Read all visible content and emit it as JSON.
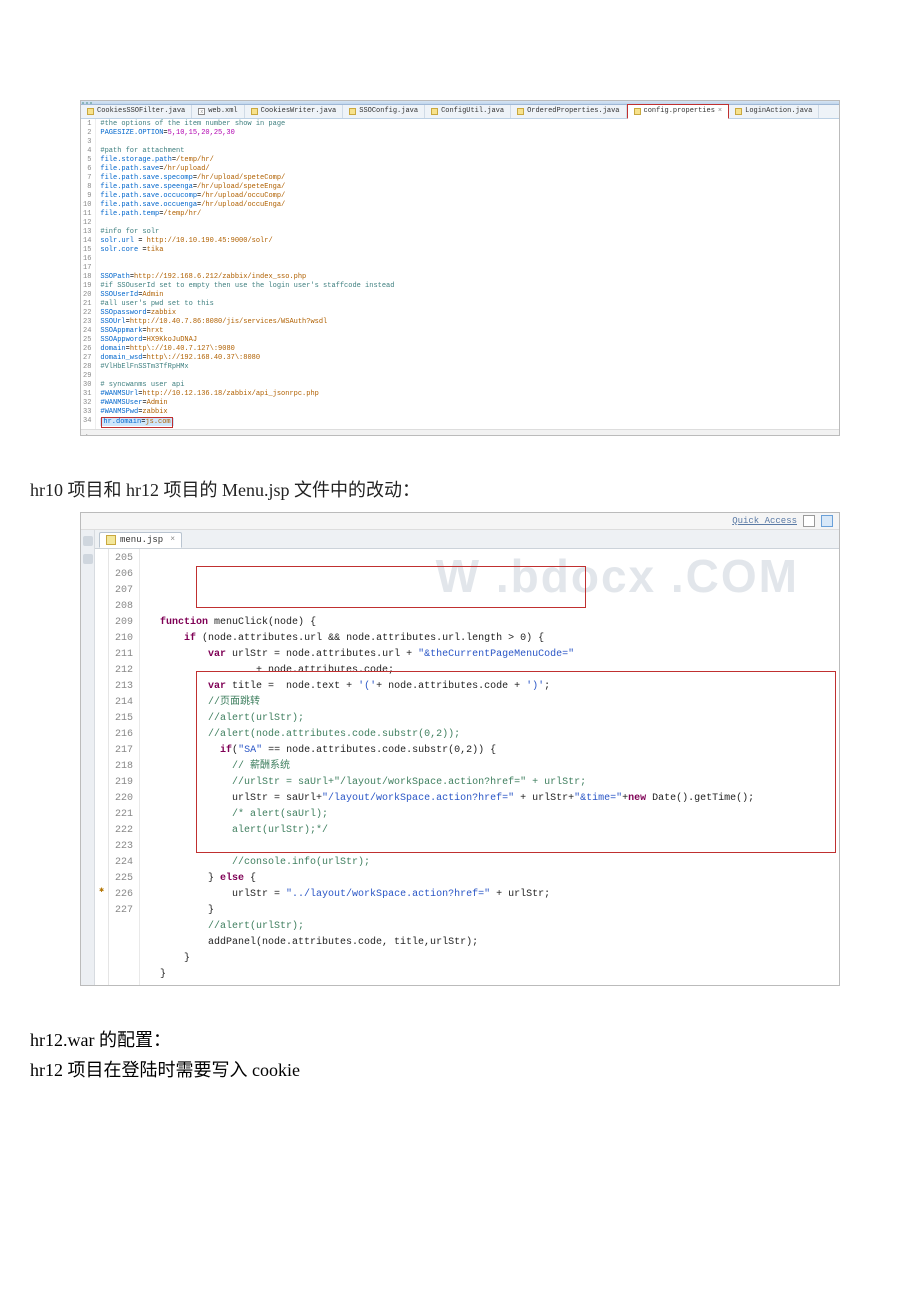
{
  "editor1": {
    "tabs": [
      {
        "icon": "java-icon",
        "label": "CookiesSSOFilter.java"
      },
      {
        "icon": "xml-icon",
        "label": "web.xml"
      },
      {
        "icon": "java-icon",
        "label": "CookiesWriter.java"
      },
      {
        "icon": "java-icon",
        "label": "SSOConfig.java"
      },
      {
        "icon": "java-icon",
        "label": "ConfigUtil.java"
      },
      {
        "icon": "java-icon",
        "label": "OrderedProperties.java"
      },
      {
        "icon": "prop-icon",
        "label": "config.properties",
        "active": true
      },
      {
        "icon": "java-icon",
        "label": "LoginAction.java"
      }
    ],
    "lines": [
      {
        "n": 1,
        "html": "<span class='c-comment'>#the options of the item number show in page</span>"
      },
      {
        "n": 2,
        "html": "<span class='c-key'>PAGESIZE.OPTION</span>=<span class='c-num'>5,10,15,20,25,30</span>"
      },
      {
        "n": 3,
        "html": ""
      },
      {
        "n": 4,
        "html": "<span class='c-comment'>#path for attachment</span>"
      },
      {
        "n": 5,
        "html": "<span class='c-key'>file.storage.path</span>=<span class='c-val'>/temp/hr/</span>"
      },
      {
        "n": 6,
        "html": "<span class='c-key'>file.path.save</span>=<span class='c-val'>/hr/upload/</span>"
      },
      {
        "n": 7,
        "html": "<span class='c-key'>file.path.save.specomp</span>=<span class='c-val'>/hr/upload/speteComp/</span>"
      },
      {
        "n": 8,
        "html": "<span class='c-key'>file.path.save.speenga</span>=<span class='c-val'>/hr/upload/speteEnga/</span>"
      },
      {
        "n": 9,
        "html": "<span class='c-key'>file.path.save.occucomp</span>=<span class='c-val'>/hr/upload/occuComp/</span>"
      },
      {
        "n": 10,
        "html": "<span class='c-key'>file.path.save.occuenga</span>=<span class='c-val'>/hr/upload/occuEnga/</span>"
      },
      {
        "n": 11,
        "html": "<span class='c-key'>file.path.temp</span>=<span class='c-val'>/temp/hr/</span>"
      },
      {
        "n": 12,
        "html": ""
      },
      {
        "n": 13,
        "html": "<span class='c-comment'>#info for solr</span>"
      },
      {
        "n": 14,
        "html": "<span class='c-key'>solr.url</span> = <span class='c-val'>http://10.10.190.45:9000/solr/</span>"
      },
      {
        "n": 15,
        "html": "<span class='c-key'>solr.core</span> =<span class='c-val'>tika</span>"
      },
      {
        "n": 16,
        "html": ""
      },
      {
        "n": 17,
        "html": ""
      },
      {
        "n": 18,
        "html": "<span class='c-key'>SSOPath</span>=<span class='c-val'>http://192.168.6.212/zabbix/index_sso.php</span>"
      },
      {
        "n": 19,
        "html": "<span class='c-comment'>#if SSOuserId set to empty then use the login user's staffcode instead</span>"
      },
      {
        "n": 20,
        "html": "<span class='c-key'>SSOUserId</span>=<span class='c-val'>Admin</span>"
      },
      {
        "n": 21,
        "html": "<span class='c-comment'>#all user's pwd set to this</span>"
      },
      {
        "n": 22,
        "html": "<span class='c-key'>SSOpassword</span>=<span class='c-val'>zabbix</span>"
      },
      {
        "n": 23,
        "html": "<span class='c-key'>SSOUrl</span>=<span class='c-val'>http://10.40.7.86:8080/jis/services/WSAuth?wsdl</span>"
      },
      {
        "n": 24,
        "html": "<span class='c-key'>SSOAppmark</span>=<span class='c-val'>hrxt</span>"
      },
      {
        "n": 25,
        "html": "<span class='c-key'>SSOAppword</span>=<span class='c-val'>HX9KkoJuDNAJ</span>"
      },
      {
        "n": 26,
        "html": "<span class='c-key'>domain</span>=<span class='c-val'>http\\://10.40.7.127\\:9080</span>"
      },
      {
        "n": 27,
        "html": "<span class='c-key'>domain_wsd</span>=<span class='c-val'>http\\://192.168.40.37\\:8080</span>"
      },
      {
        "n": 28,
        "html": "<span class='c-comment'>#VlHbElFnSSTm3TfRpHMx</span>"
      },
      {
        "n": 29,
        "html": ""
      },
      {
        "n": 30,
        "html": "<span class='c-comment'># syncwanms user api</span>"
      },
      {
        "n": 31,
        "html": "<span class='c-key'>#WANMSUrl</span>=<span class='c-val'>http://10.12.136.18/zabbix/api_jsonrpc.php</span>"
      },
      {
        "n": 32,
        "html": "<span class='c-key'>#WANMSUser</span>=<span class='c-val'>Admin</span>"
      },
      {
        "n": 33,
        "html": "<span class='c-key'>#WANMSPwd</span>=<span class='c-val'>zabbix</span>"
      },
      {
        "n": 34,
        "html": "<span class='ed1-hl-cursor'><span class='c-key'>hr.domain</span>=<span class='c-val'>js.com</span></span>"
      }
    ],
    "footer": "."
  },
  "bodyText1": "hr10 项目和 hr12 项目的 Menu.jsp 文件中的改动：",
  "editor2": {
    "topbar": {
      "quickAccess": "Quick Access"
    },
    "tab": {
      "label": "menu.jsp",
      "close": "×"
    },
    "watermark": "W .bdocx .COM",
    "lines": [
      {
        "n": 205,
        "html": "  <span class='js-kw'>function</span> menuClick(node) {"
      },
      {
        "n": 206,
        "html": "      <span class='js-kw'>if</span> (node.attributes.url && node.attributes.url.length &gt; 0) {"
      },
      {
        "n": 207,
        "html": "          <span class='js-kw'>var</span> urlStr = node.attributes.url + <span class='js-str'>\"&amp;theCurrentPageMenuCode=\"</span>"
      },
      {
        "n": 208,
        "html": "                  + node.attributes.code;"
      },
      {
        "n": 209,
        "html": "          <span class='js-kw'>var</span> title =  node.text + <span class='js-str'>'('</span>+ node.attributes.code + <span class='js-str'>')'</span>;"
      },
      {
        "n": 210,
        "html": "          <span class='js-com'>//页面跳转</span>"
      },
      {
        "n": 211,
        "html": "          <span class='js-com'>//alert(urlStr);</span>"
      },
      {
        "n": 212,
        "html": "          <span class='js-com'>//alert(node.attributes.code.substr(0,2));</span>"
      },
      {
        "n": 213,
        "html": "            <span class='js-kw'>if</span>(<span class='js-str'>\"SA\"</span> == node.attributes.code.substr(0,2)) {"
      },
      {
        "n": 214,
        "html": "              <span class='js-com'>// 薪酬系统</span>"
      },
      {
        "n": 215,
        "html": "              <span class='js-com'>//urlStr = saUrl+\"/layout/workSpace.action?href=\" + urlStr;</span>"
      },
      {
        "n": 216,
        "html": "              urlStr = saUrl+<span class='js-str'>\"/layout/workSpace.action?href=\"</span> + urlStr+<span class='js-str'>\"&amp;time=\"</span>+<span class='js-kw'>new</span> Date().getTime();"
      },
      {
        "n": 217,
        "html": "              <span class='js-com'>/* alert(saUrl);</span>"
      },
      {
        "n": 218,
        "html": "<span class='js-com'>              alert(urlStr);*/</span>"
      },
      {
        "n": 219,
        "html": ""
      },
      {
        "n": 220,
        "html": "              <span class='js-com'>//console.info(urlStr);</span>"
      },
      {
        "n": 221,
        "html": "          } <span class='js-kw'>else</span> {"
      },
      {
        "n": 222,
        "html": "              urlStr = <span class='js-str'>\"../layout/workSpace.action?href=\"</span> + urlStr;"
      },
      {
        "n": 223,
        "html": "          }"
      },
      {
        "n": 224,
        "html": "          <span class='js-com'>//alert(urlStr);</span>"
      },
      {
        "n": 225,
        "html": "          addPanel(node.attributes.code, title,urlStr);"
      },
      {
        "n": 226,
        "mark": "star",
        "html": "      }"
      },
      {
        "n": 227,
        "html": "  }"
      }
    ]
  },
  "finalText1": "hr12.war 的配置：",
  "finalText2": "hr12 项目在登陆时需要写入 cookie"
}
